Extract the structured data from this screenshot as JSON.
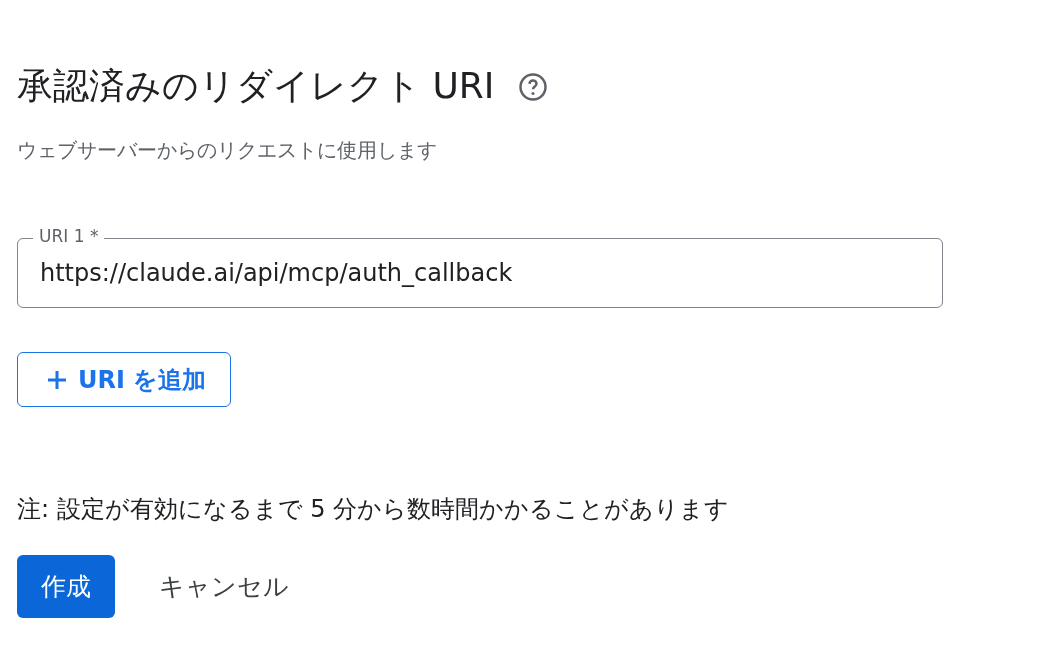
{
  "title": "承認済みのリダイレクト URI",
  "subtitle": "ウェブサーバーからのリクエストに使用します",
  "uris": [
    {
      "label": "URI 1 *",
      "value": "https://claude.ai/api/mcp/auth_callback"
    }
  ],
  "add_button": "URI を追加",
  "note": "注: 設定が有効になるまで 5 分から数時間かかることがあります",
  "buttons": [
    {
      "label": "作成",
      "kind": "primary"
    },
    {
      "label": "キャンセル",
      "kind": "text"
    }
  ]
}
